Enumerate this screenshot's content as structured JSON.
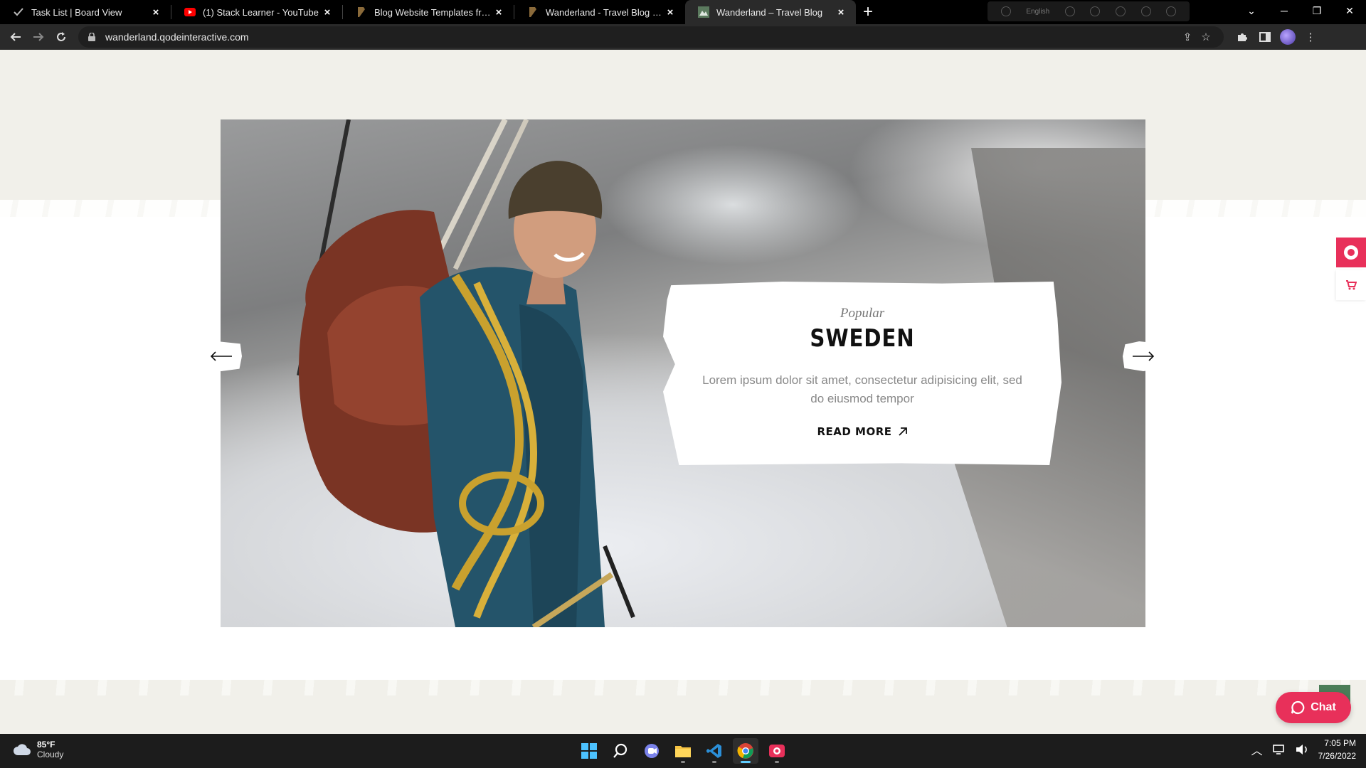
{
  "browser": {
    "tabs": [
      {
        "title": "Task List | Board View",
        "favicon": "check-favicon"
      },
      {
        "title": "(1) Stack Learner - YouTube",
        "favicon": "youtube-favicon"
      },
      {
        "title": "Blog Website Templates from The",
        "favicon": "themeforest-favicon"
      },
      {
        "title": "Wanderland - Travel Blog Preview",
        "favicon": "themeforest-favicon"
      },
      {
        "title": "Wanderland – Travel Blog",
        "favicon": "wanderland-favicon",
        "active": true
      }
    ],
    "ext_language": "English",
    "url": "wanderland.qodeinteractive.com"
  },
  "slider": {
    "kicker": "Popular",
    "title": "SWEDEN",
    "description": "Lorem ipsum dolor sit amet, consectetur adipisicing elit, sed do eiusmod tempor",
    "read_more": "READ MORE"
  },
  "chat": {
    "label": "Chat"
  },
  "taskbar": {
    "weather_temp": "85°F",
    "weather_cond": "Cloudy",
    "time": "7:05 PM",
    "date": "7/26/2022"
  },
  "colors": {
    "accent": "#e8305a",
    "page_bg": "#f1f0ea",
    "scroll_top": "#4b7d58"
  }
}
